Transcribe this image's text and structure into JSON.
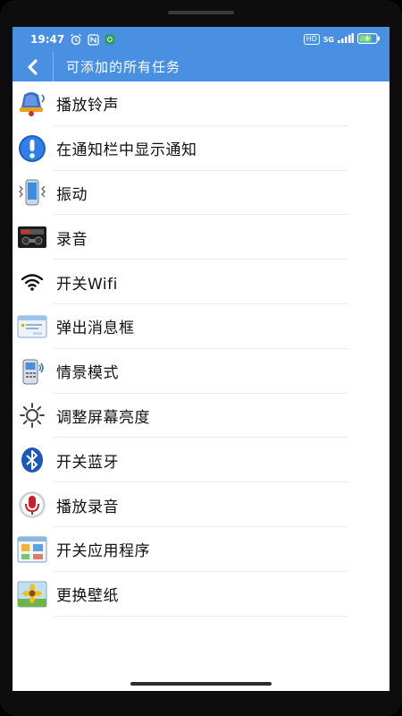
{
  "status_bar": {
    "time": "19:47",
    "network": "5G",
    "hd": "HD",
    "battery_icon": "battery-charging-icon"
  },
  "app_bar": {
    "title": "可添加的所有任务",
    "back_icon": "chevron-left-icon"
  },
  "tasks": [
    {
      "label": "播放铃声",
      "icon": "bell-icon"
    },
    {
      "label": "在通知栏中显示通知",
      "icon": "info-icon"
    },
    {
      "label": "振动",
      "icon": "vibrate-phone-icon"
    },
    {
      "label": "录音",
      "icon": "recorder-icon"
    },
    {
      "label": "开关Wifi",
      "icon": "wifi-icon"
    },
    {
      "label": "弹出消息框",
      "icon": "dialog-box-icon"
    },
    {
      "label": "情景模式",
      "icon": "phone-profile-icon"
    },
    {
      "label": "调整屏幕亮度",
      "icon": "brightness-icon"
    },
    {
      "label": "开关蓝牙",
      "icon": "bluetooth-icon"
    },
    {
      "label": "播放录音",
      "icon": "microphone-icon"
    },
    {
      "label": "开关应用程序",
      "icon": "app-grid-icon"
    },
    {
      "label": "更换壁纸",
      "icon": "wallpaper-icon"
    }
  ],
  "colors": {
    "accent": "#4a90e2",
    "background": "#ffffff",
    "text": "#111111"
  }
}
